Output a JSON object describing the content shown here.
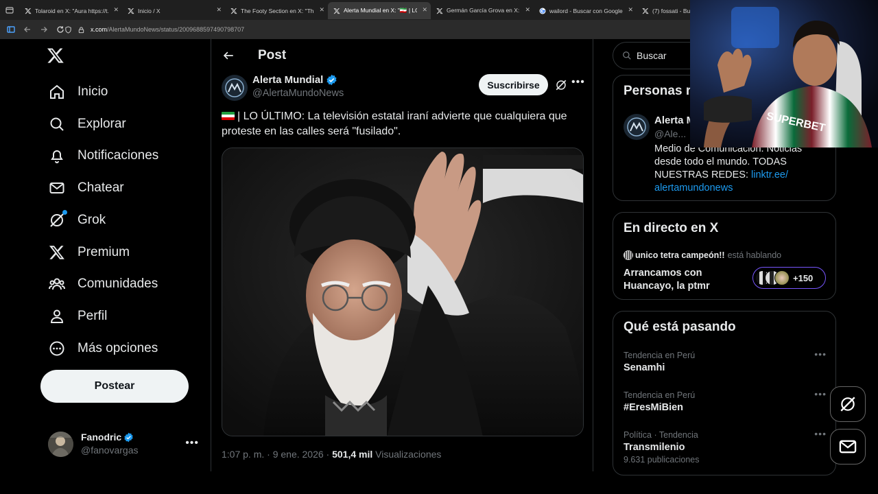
{
  "browser": {
    "tabs": [
      {
        "title": "Tolaroid en X: \"Aura https://t.co",
        "icon": "x-logo-icon",
        "active": false
      },
      {
        "title": "Inicio / X",
        "icon": "x-logo-icon",
        "active": false
      },
      {
        "title": "The Footy Section en X: \"This pl",
        "icon": "x-logo-icon",
        "active": false
      },
      {
        "title": "Alerta Mundial en X: \"🇮🇷 | LO ÚL",
        "icon": "x-logo-icon",
        "active": true
      },
      {
        "title": "Germán García Grova en X: \"🧟",
        "icon": "x-logo-icon",
        "active": false
      },
      {
        "title": "wailord - Buscar con Google",
        "icon": "google-icon",
        "active": false
      },
      {
        "title": "(7) fossati - Busc",
        "icon": "x-logo-icon",
        "active": false
      }
    ],
    "url_host": "x.com",
    "url_path": "/AlertaMundoNews/status/2009688597490798707"
  },
  "nav": {
    "items": [
      {
        "label": "Inicio",
        "icon": "home-icon"
      },
      {
        "label": "Explorar",
        "icon": "search-icon"
      },
      {
        "label": "Notificaciones",
        "icon": "bell-icon"
      },
      {
        "label": "Chatear",
        "icon": "mail-icon"
      },
      {
        "label": "Grok",
        "icon": "grok-icon"
      },
      {
        "label": "Premium",
        "icon": "x-logo-icon"
      },
      {
        "label": "Comunidades",
        "icon": "communities-icon"
      },
      {
        "label": "Perfil",
        "icon": "person-icon"
      },
      {
        "label": "Más opciones",
        "icon": "more-circle-icon"
      }
    ],
    "post_button": "Postear",
    "account": {
      "name": "Fanodric",
      "handle": "@fanovargas"
    }
  },
  "post": {
    "header_title": "Post",
    "author_name": "Alerta Mundial",
    "author_handle": "@AlertaMundoNews",
    "subscribe_label": "Suscribirse",
    "text": "| LO ÚLTIMO: La televisión estatal iraní advierte que cualquiera que proteste en las calles será \"fusilado\".",
    "timestamp": "1:07 p. m. · 9 ene. 2026 ·",
    "views_count": "501,4 mil",
    "views_label": "Visualizaciones"
  },
  "sidebar": {
    "search_placeholder": "Buscar",
    "relevant": {
      "title": "Personas r",
      "name": "Alerta M",
      "handle": "@Ale...",
      "bio": "Medio de Comunicación. Noticias desde todo el mundo. TODAS NUESTRAS REDES: ",
      "bio_link_1": "linktr.ee/",
      "bio_link_2": "alertamundonews"
    },
    "live": {
      "title": "En directo en X",
      "host": "unico tetra campeón!!",
      "host_suffix": "está hablando",
      "space_title": "Arrancamos con Huancayo, la ptmr",
      "listeners": "+150"
    },
    "trends": {
      "title": "Qué está pasando",
      "items": [
        {
          "context": "Tendencia en Perú",
          "topic": "Senamhi",
          "count": ""
        },
        {
          "context": "Tendencia en Perú",
          "topic": "#EresMiBien",
          "count": ""
        },
        {
          "context": "Política · Tendencia",
          "topic": "Transmilenio",
          "count": "9.631 publicaciones"
        }
      ]
    }
  },
  "colors": {
    "accent": "#1d9bf0",
    "background": "#000000",
    "border": "#2f3336",
    "muted": "#71767b",
    "live": "#7856ff"
  }
}
